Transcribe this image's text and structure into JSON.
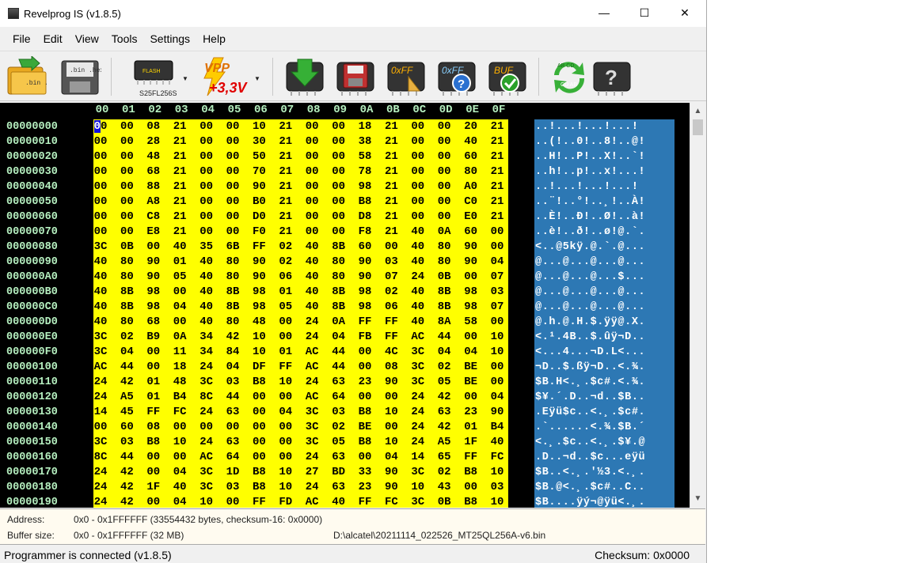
{
  "window": {
    "title": "Revelprog IS (v1.8.5)",
    "minimize": "—",
    "maximize": "☐",
    "close": "✕"
  },
  "menu": [
    "File",
    "Edit",
    "View",
    "Tools",
    "Settings",
    "Help"
  ],
  "toolbar": {
    "open_label": ".bin .hex",
    "save_label": ".bin .hex",
    "chip_name": "S25FL256S",
    "chip_badge": "FLASH",
    "vpp_label": "VPP",
    "vpp_voltage": "+3,3V",
    "fill_ff_label": "0xFF",
    "check_ff_label": "0xFF",
    "buf_label": "BUF",
    "swap_label_a": "AB CD",
    "swap_label_b": "CD AB",
    "help_label": "?"
  },
  "hex": {
    "columns": [
      "00",
      "01",
      "02",
      "03",
      "04",
      "05",
      "06",
      "07",
      "08",
      "09",
      "0A",
      "0B",
      "0C",
      "0D",
      "0E",
      "0F"
    ],
    "rows": [
      {
        "addr": "00000000",
        "bytes": [
          "00",
          "00",
          "08",
          "21",
          "00",
          "00",
          "10",
          "21",
          "00",
          "00",
          "18",
          "21",
          "00",
          "00",
          "20",
          "21"
        ],
        "ascii": "..!...!...!...!"
      },
      {
        "addr": "00000010",
        "bytes": [
          "00",
          "00",
          "28",
          "21",
          "00",
          "00",
          "30",
          "21",
          "00",
          "00",
          "38",
          "21",
          "00",
          "00",
          "40",
          "21"
        ],
        "ascii": "..(!..0!..8!..@!"
      },
      {
        "addr": "00000020",
        "bytes": [
          "00",
          "00",
          "48",
          "21",
          "00",
          "00",
          "50",
          "21",
          "00",
          "00",
          "58",
          "21",
          "00",
          "00",
          "60",
          "21"
        ],
        "ascii": "..H!..P!..X!..`!"
      },
      {
        "addr": "00000030",
        "bytes": [
          "00",
          "00",
          "68",
          "21",
          "00",
          "00",
          "70",
          "21",
          "00",
          "00",
          "78",
          "21",
          "00",
          "00",
          "80",
          "21"
        ],
        "ascii": "..h!..p!..x!...!"
      },
      {
        "addr": "00000040",
        "bytes": [
          "00",
          "00",
          "88",
          "21",
          "00",
          "00",
          "90",
          "21",
          "00",
          "00",
          "98",
          "21",
          "00",
          "00",
          "A0",
          "21"
        ],
        "ascii": "..!...!...!...!"
      },
      {
        "addr": "00000050",
        "bytes": [
          "00",
          "00",
          "A8",
          "21",
          "00",
          "00",
          "B0",
          "21",
          "00",
          "00",
          "B8",
          "21",
          "00",
          "00",
          "C0",
          "21"
        ],
        "ascii": "..¨!..°!..¸!..À!"
      },
      {
        "addr": "00000060",
        "bytes": [
          "00",
          "00",
          "C8",
          "21",
          "00",
          "00",
          "D0",
          "21",
          "00",
          "00",
          "D8",
          "21",
          "00",
          "00",
          "E0",
          "21"
        ],
        "ascii": "..È!..Ð!..Ø!..à!"
      },
      {
        "addr": "00000070",
        "bytes": [
          "00",
          "00",
          "E8",
          "21",
          "00",
          "00",
          "F0",
          "21",
          "00",
          "00",
          "F8",
          "21",
          "40",
          "0A",
          "60",
          "00"
        ],
        "ascii": "..è!..ð!..ø!@.`."
      },
      {
        "addr": "00000080",
        "bytes": [
          "3C",
          "0B",
          "00",
          "40",
          "35",
          "6B",
          "FF",
          "02",
          "40",
          "8B",
          "60",
          "00",
          "40",
          "80",
          "90",
          "00"
        ],
        "ascii": "<..@5kÿ.@.`.@..."
      },
      {
        "addr": "00000090",
        "bytes": [
          "40",
          "80",
          "90",
          "01",
          "40",
          "80",
          "90",
          "02",
          "40",
          "80",
          "90",
          "03",
          "40",
          "80",
          "90",
          "04"
        ],
        "ascii": "@...@...@...@..."
      },
      {
        "addr": "000000A0",
        "bytes": [
          "40",
          "80",
          "90",
          "05",
          "40",
          "80",
          "90",
          "06",
          "40",
          "80",
          "90",
          "07",
          "24",
          "0B",
          "00",
          "07"
        ],
        "ascii": "@...@...@...$..."
      },
      {
        "addr": "000000B0",
        "bytes": [
          "40",
          "8B",
          "98",
          "00",
          "40",
          "8B",
          "98",
          "01",
          "40",
          "8B",
          "98",
          "02",
          "40",
          "8B",
          "98",
          "03"
        ],
        "ascii": "@...@...@...@..."
      },
      {
        "addr": "000000C0",
        "bytes": [
          "40",
          "8B",
          "98",
          "04",
          "40",
          "8B",
          "98",
          "05",
          "40",
          "8B",
          "98",
          "06",
          "40",
          "8B",
          "98",
          "07"
        ],
        "ascii": "@...@...@...@..."
      },
      {
        "addr": "000000D0",
        "bytes": [
          "40",
          "80",
          "68",
          "00",
          "40",
          "80",
          "48",
          "00",
          "24",
          "0A",
          "FF",
          "FF",
          "40",
          "8A",
          "58",
          "00"
        ],
        "ascii": "@.h.@.H.$.ÿÿ@.X."
      },
      {
        "addr": "000000E0",
        "bytes": [
          "3C",
          "02",
          "B9",
          "0A",
          "34",
          "42",
          "10",
          "00",
          "24",
          "04",
          "FB",
          "FF",
          "AC",
          "44",
          "00",
          "10"
        ],
        "ascii": "<.¹.4B..$.ûÿ¬D.."
      },
      {
        "addr": "000000F0",
        "bytes": [
          "3C",
          "04",
          "00",
          "11",
          "34",
          "84",
          "10",
          "01",
          "AC",
          "44",
          "00",
          "4C",
          "3C",
          "04",
          "04",
          "10"
        ],
        "ascii": "<...4...¬D.L<..."
      },
      {
        "addr": "00000100",
        "bytes": [
          "AC",
          "44",
          "00",
          "18",
          "24",
          "04",
          "DF",
          "FF",
          "AC",
          "44",
          "00",
          "08",
          "3C",
          "02",
          "BE",
          "00"
        ],
        "ascii": "¬D..$.ßÿ¬D..<.¾."
      },
      {
        "addr": "00000110",
        "bytes": [
          "24",
          "42",
          "01",
          "48",
          "3C",
          "03",
          "B8",
          "10",
          "24",
          "63",
          "23",
          "90",
          "3C",
          "05",
          "BE",
          "00"
        ],
        "ascii": "$B.H<.¸.$c#.<.¾."
      },
      {
        "addr": "00000120",
        "bytes": [
          "24",
          "A5",
          "01",
          "B4",
          "8C",
          "44",
          "00",
          "00",
          "AC",
          "64",
          "00",
          "00",
          "24",
          "42",
          "00",
          "04"
        ],
        "ascii": "$¥.´.D..¬d..$B.."
      },
      {
        "addr": "00000130",
        "bytes": [
          "14",
          "45",
          "FF",
          "FC",
          "24",
          "63",
          "00",
          "04",
          "3C",
          "03",
          "B8",
          "10",
          "24",
          "63",
          "23",
          "90"
        ],
        "ascii": ".Eÿü$c..<.¸.$c#."
      },
      {
        "addr": "00000140",
        "bytes": [
          "00",
          "60",
          "08",
          "00",
          "00",
          "00",
          "00",
          "00",
          "3C",
          "02",
          "BE",
          "00",
          "24",
          "42",
          "01",
          "B4"
        ],
        "ascii": ".`......<.¾.$B.´"
      },
      {
        "addr": "00000150",
        "bytes": [
          "3C",
          "03",
          "B8",
          "10",
          "24",
          "63",
          "00",
          "00",
          "3C",
          "05",
          "B8",
          "10",
          "24",
          "A5",
          "1F",
          "40"
        ],
        "ascii": "<.¸.$c..<.¸.$¥.@"
      },
      {
        "addr": "00000160",
        "bytes": [
          "8C",
          "44",
          "00",
          "00",
          "AC",
          "64",
          "00",
          "00",
          "24",
          "63",
          "00",
          "04",
          "14",
          "65",
          "FF",
          "FC"
        ],
        "ascii": ".D..¬d..$c...eÿü"
      },
      {
        "addr": "00000170",
        "bytes": [
          "24",
          "42",
          "00",
          "04",
          "3C",
          "1D",
          "B8",
          "10",
          "27",
          "BD",
          "33",
          "90",
          "3C",
          "02",
          "B8",
          "10"
        ],
        "ascii": "$B..<.¸.'½3.<.¸."
      },
      {
        "addr": "00000180",
        "bytes": [
          "24",
          "42",
          "1F",
          "40",
          "3C",
          "03",
          "B8",
          "10",
          "24",
          "63",
          "23",
          "90",
          "10",
          "43",
          "00",
          "03"
        ],
        "ascii": "$B.@<.¸.$c#..C.."
      },
      {
        "addr": "00000190",
        "bytes": [
          "24",
          "42",
          "00",
          "04",
          "10",
          "00",
          "FF",
          "FD",
          "AC",
          "40",
          "FF",
          "FC",
          "3C",
          "0B",
          "B8",
          "10"
        ],
        "ascii": "$B....ÿý¬@ÿü<.¸."
      }
    ]
  },
  "info": {
    "address_label": "Address:",
    "address_value": "0x0 - 0x1FFFFFF (33554432 bytes, checksum-16: 0x0000)",
    "buffer_label": "Buffer size:",
    "buffer_value": "0x0 - 0x1FFFFFF (32 MB)",
    "file_path": "D:\\alcatel\\20211114_022526_MT25QL256A-v6.bin"
  },
  "status": {
    "left": "Programmer is connected (v1.8.5)",
    "right": "Checksum: 0x0000"
  },
  "colors": {
    "hex_bg": "#ffff00",
    "ascii_bg": "#2d78b4",
    "pane_bg": "#000000",
    "addr_fg": "#b6f0c0"
  }
}
